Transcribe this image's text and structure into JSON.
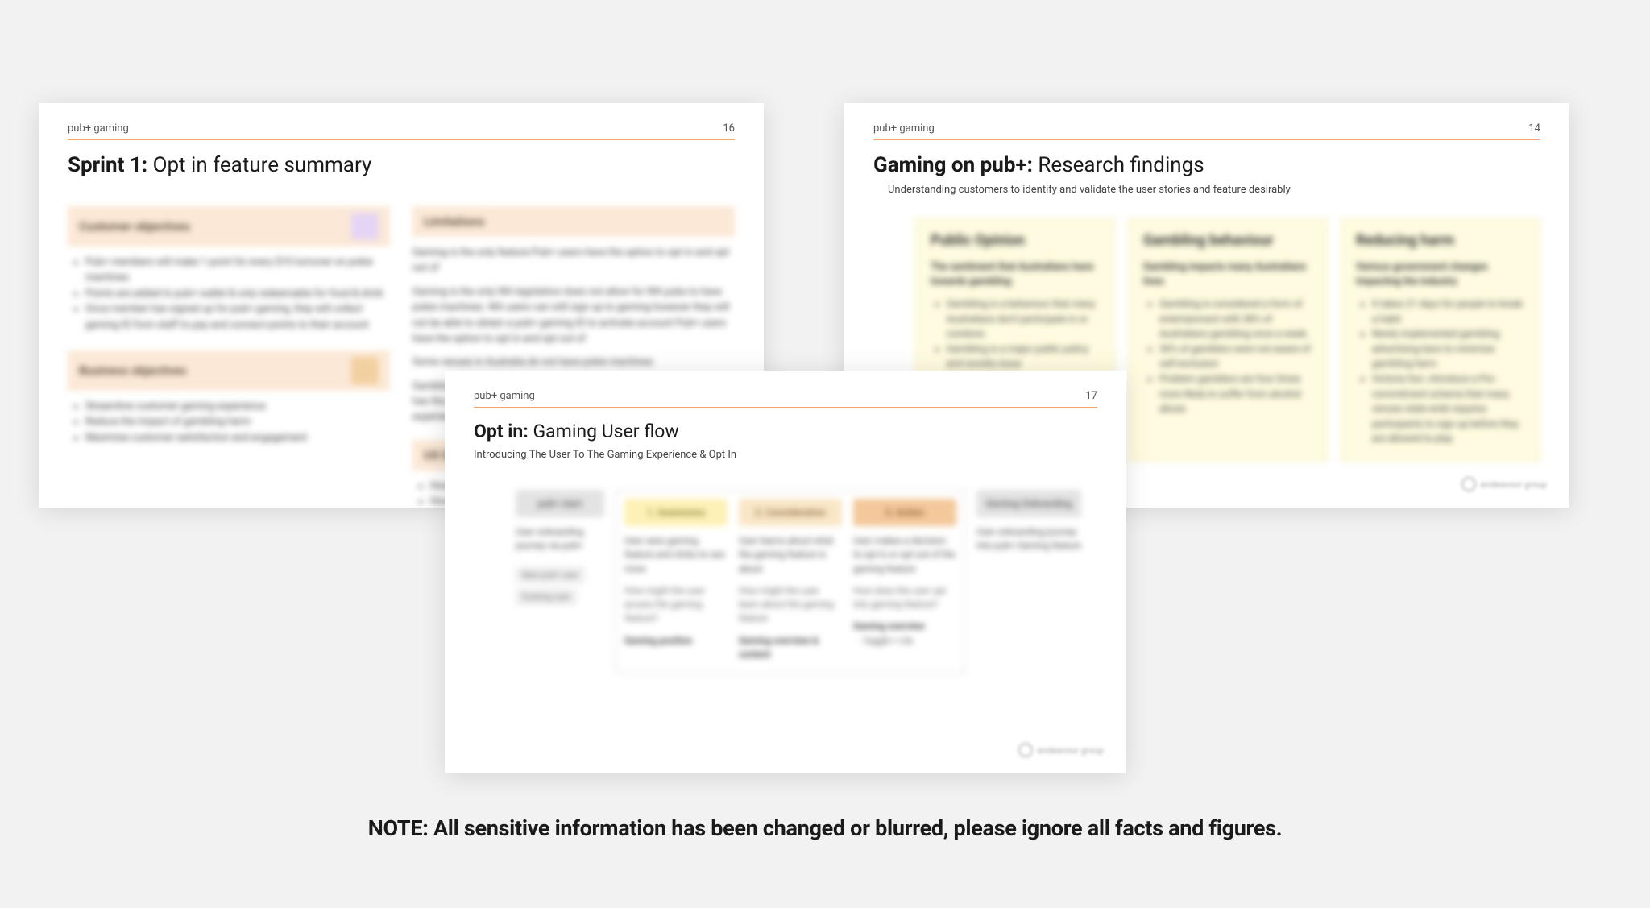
{
  "branding": "pub+ gaming",
  "footer_logo": "endeavour group",
  "note": "NOTE: All sensitive information has been changed or blurred, please ignore all facts and figures.",
  "slide_left": {
    "page": "16",
    "title_bold": "Sprint 1:",
    "title_rest": " Opt in feature summary",
    "col1": {
      "band1": "Customer objectives",
      "bullets1": [
        "Pub+ members will make 1 point for every $10 turnover on pokie machines",
        "Points are added to pub+ wallet & only redeemable for food & drink",
        "Once member has signed up for pub+ gaming, they will collect gaming ID from staff to pay and connect points to their account"
      ],
      "band2": "Business objectives",
      "bullets2": [
        "Streamline customer gaming experience",
        "Reduce the impact of gambling harm",
        "Maximise customer satisfaction and engagement"
      ]
    },
    "col2": {
      "band1": "Limitations",
      "paras": [
        "Gaming is the only feature Pub+ users have the option to opt in and opt out of",
        "Gaming is the only WA legislation does not allow for WA pubs to have pokie machines. WA users can still sign up to gaming however they will not be able to obtain a pub+ gaming ID to activate account Pub+ users have the option to opt in and opt out of",
        "Some venues in Australia do not have pokie machines",
        "Gambling is a conflicting topic for many Australians, gaming on pub+ has the potential to negatively impact an individual's overall pub+ experience"
      ],
      "band2": "UX Exploration",
      "bullets2": [
        "How might we display the gaming feature within the app",
        "How might we allow users to opt in and opt out easily"
      ]
    }
  },
  "slide_right": {
    "page": "14",
    "title_bold": "Gaming on pub+:",
    "title_rest": " Research findings",
    "subtitle": "Understanding customers to identify and validate the user stories and feature desirably",
    "cards": [
      {
        "title": "Public Opinion",
        "lead": "The sentiment that Australians have towards gambling",
        "bullets": [
          "Gambling is a behaviour that many Australians don't participate in or condone.",
          "Gambling is a major public policy and society issue"
        ]
      },
      {
        "title": "Gambling behaviour",
        "lead": "Gambling impacts many Australians lives",
        "bullets": [
          "Gambling is considered a form of entertainment with 38% of Australians gambling once a week.",
          "30% of gamblers were not aware of self-exclusion",
          "Problem gamblers are four times more likely to suffer from alcohol abuse"
        ]
      },
      {
        "title": "Reducing harm",
        "lead": "Various government changes impacting the industry",
        "bullets": [
          "It takes 21 days for people to break a habit",
          "Newly implemented gambling advertising laws to minimise gambling harm",
          "Victoria Gov. introduce a Pre-commitment scheme that many venues state-wide requires participants to sign up before they are allowed to play."
        ]
      }
    ]
  },
  "slide_center": {
    "page": "17",
    "title_bold": "Opt in:",
    "title_rest": " Gaming User flow",
    "subtitle": "Introducing The User To The Gaming Experience & Opt In",
    "flow": {
      "start": {
        "chip": "pub+ start",
        "desc": "User onboarding journey via pub+",
        "mini1": "New pub+ user",
        "mini2": "Existing user"
      },
      "step1": {
        "chip": "1. Awareness",
        "desc": "User sees gaming feature and clicks to see more",
        "q": "How might the user access the gaming feature?",
        "foot": "Gaming position"
      },
      "step2": {
        "chip": "2. Consideration",
        "desc": "User learns about what the gaming feature is about",
        "q": "How might the user learn about the gaming feature",
        "foot": "Gaming overview & content"
      },
      "step3": {
        "chip": "3. Action",
        "desc": "User makes a decision to opt in or opt out of the gaming feature",
        "q": "How does the user opt into gaming feature?",
        "foot": "Gaming overview",
        "foot_sub": "- toggle + cta"
      },
      "end": {
        "chip": "Gaming Onboarding",
        "desc": "User onboarding journey into pub+ Gaming feature"
      }
    }
  }
}
